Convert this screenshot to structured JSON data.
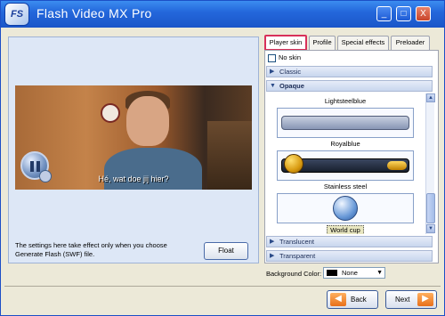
{
  "window": {
    "title": "Flash Video MX Pro",
    "logo_text": "FS",
    "controls": {
      "minimize": "_",
      "maximize": "□",
      "close": "X"
    }
  },
  "preview": {
    "subtitle": "Hé, wat doe jij hier?",
    "note": "The settings here take effect only when you choose Generate Flash (SWF) file.",
    "float_label": "Float"
  },
  "tabs": [
    {
      "label": "Player skin",
      "active": true
    },
    {
      "label": "Profile",
      "active": false
    },
    {
      "label": "Special effects",
      "active": false
    },
    {
      "label": "Preloader",
      "active": false
    }
  ],
  "player_skin": {
    "no_skin_label": "No skin",
    "groups": {
      "classic": "Classic",
      "opaque": "Opaque",
      "translucent": "Translucent",
      "transparent": "Transparent"
    },
    "skins": [
      {
        "name": "Lightsteelblue",
        "selected": false
      },
      {
        "name": "Royalblue",
        "selected": false
      },
      {
        "name": "Stainless steel",
        "selected": false
      },
      {
        "name": "World cup",
        "selected": true
      }
    ],
    "background_label": "Background Color:",
    "background_value": "None",
    "background_swatch": "#000000"
  },
  "nav": {
    "back_label": "Back",
    "next_label": "Next"
  },
  "colors": {
    "titlebar": "#2468dc",
    "active_tab_border": "#d8305a",
    "nav_arrow": "#e8701a"
  }
}
